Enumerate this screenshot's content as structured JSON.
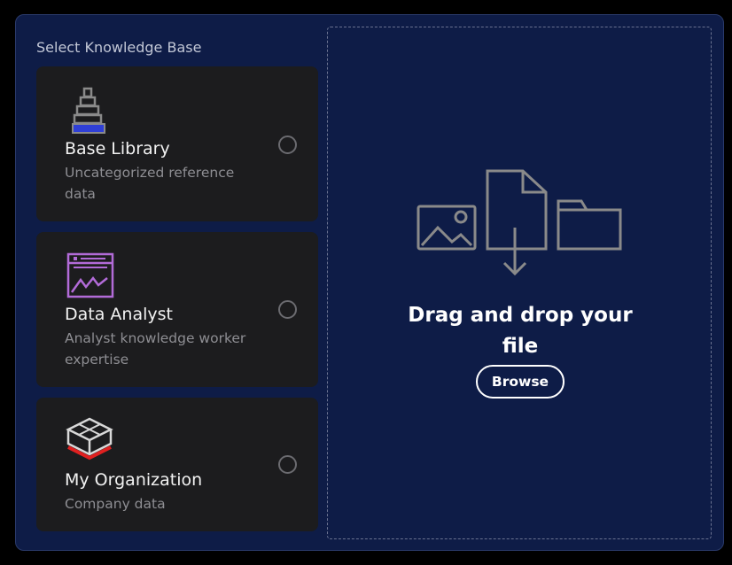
{
  "section_label": "Select Knowledge Base",
  "knowledge_bases": [
    {
      "title": "Base Library",
      "description": "Uncategorized reference data",
      "icon": "tower-stack-icon",
      "accent": "#2f3fd6",
      "selected": false
    },
    {
      "title": "Data Analyst",
      "description": "Analyst knowledge worker expertise",
      "icon": "chart-window-icon",
      "accent": "#b26bd8",
      "selected": false
    },
    {
      "title": "My Organization",
      "description": "Company data",
      "icon": "box-frame-icon",
      "accent": "#e02020",
      "selected": false
    }
  ],
  "dropzone": {
    "text": "Drag and drop your file",
    "browse_label": "Browse",
    "illustration_icons": [
      "image-icon",
      "download-file-icon",
      "folder-icon"
    ]
  },
  "colors": {
    "panel_bg": "#0e1c47",
    "card_bg": "#1c1c1e",
    "icon_gray": "#8a8a8a"
  }
}
